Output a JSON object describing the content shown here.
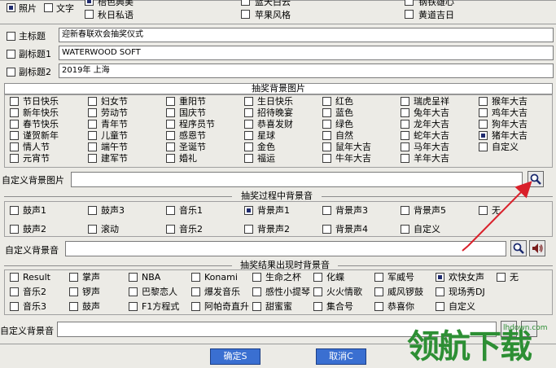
{
  "top": {
    "photo": "照片",
    "text": "文字",
    "col1": [
      "梧色典美",
      "秋日私语"
    ],
    "col2": [
      "蓝天白云",
      "苹果风格"
    ],
    "col3": [
      "钢铁雄心",
      "黄道吉日"
    ]
  },
  "titles": {
    "main_label": "主标题",
    "main_value": "迎新春联欢会抽奖仪式",
    "sub1_label": "副标题1",
    "sub1_value": "WATERWOOD SOFT",
    "sub2_label": "副标题2",
    "sub2_value": "2019年 上海"
  },
  "bg": {
    "title": "抽奖背景图片",
    "columns": [
      [
        "节日快乐",
        "新年快乐",
        "春节快乐",
        "谨贺新年",
        "情人节",
        "元宵节"
      ],
      [
        "妇女节",
        "劳动节",
        "青年节",
        "儿童节",
        "端午节",
        "建军节"
      ],
      [
        "重阳节",
        "国庆节",
        "程序员节",
        "感恩节",
        "圣诞节",
        "婚礼"
      ],
      [
        "生日快乐",
        "招待晚宴",
        "恭喜发财",
        "星球",
        "金色",
        "福运"
      ],
      [
        "红色",
        "蓝色",
        "绿色",
        "自然",
        "鼠年大吉",
        "牛年大吉"
      ],
      [
        "瑞虎呈祥",
        "兔年大吉",
        "龙年大吉",
        "蛇年大吉",
        "马年大吉",
        "羊年大吉"
      ],
      [
        "猴年大吉",
        "鸡年大吉",
        "狗年大吉",
        "猪年大吉",
        "自定义"
      ]
    ],
    "custom_label": "自定义背景图片"
  },
  "during": {
    "title": "抽奖过程中背景音",
    "row1": [
      "鼓声1",
      "鼓声3",
      "音乐1",
      "背景声1",
      "背景声3",
      "背景声5",
      "无"
    ],
    "row2": [
      "鼓声2",
      "滚动",
      "音乐2",
      "背景声2",
      "背景声4",
      "自定义"
    ],
    "custom_label": "自定义背景音"
  },
  "result": {
    "title": "抽奖结果出现时背景音",
    "row1": [
      "Result",
      "掌声",
      "NBA",
      "Konami",
      "生命之杯",
      "化蝶",
      "军威号",
      "欢快女声",
      "无"
    ],
    "row2": [
      "音乐2",
      "锣声",
      "巴黎恋人",
      "爆发音乐",
      "感性小提琴",
      "火火情歌",
      "威风锣鼓",
      "现场秀DJ"
    ],
    "row3": [
      "音乐3",
      "鼓声",
      "F1方程式",
      "阿帕奇直升",
      "甜蜜蜜",
      "集合号",
      "恭喜你",
      "自定义"
    ],
    "custom_label": "自定义背景音"
  },
  "buttons": {
    "ok": "确定S",
    "cancel": "取消C"
  },
  "watermark": {
    "text": "领航下载",
    "url": "lhdown.com"
  },
  "colors": {
    "button": "#3a6fd1",
    "arrow": "#d9202a",
    "watermark": "#2d8f34"
  }
}
